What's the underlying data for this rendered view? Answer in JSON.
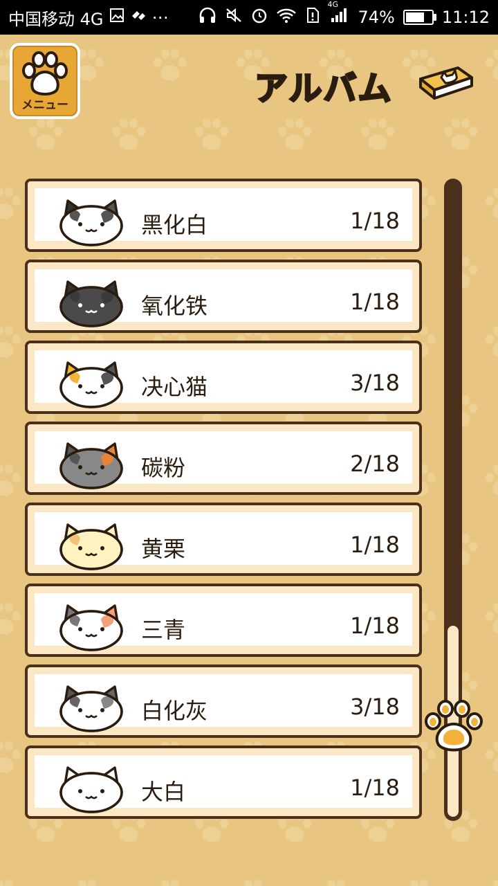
{
  "status_bar": {
    "carrier": "中国移动 4G",
    "network": "4G",
    "battery_percent": "74%",
    "battery_level": 0.74,
    "time": "11:12"
  },
  "header": {
    "menu_label": "メニュー",
    "title": "アルバム"
  },
  "colors": {
    "background": "#e8c681",
    "accent": "#e8a634",
    "border": "#4a2f1a",
    "row_bg": "#fbe7c3"
  },
  "cats": [
    {
      "name": "黑化白",
      "count": "1/18",
      "coat": "white-black"
    },
    {
      "name": "氧化铁",
      "count": "1/18",
      "coat": "dark-gray"
    },
    {
      "name": "决心猫",
      "count": "3/18",
      "coat": "calico"
    },
    {
      "name": "碳粉",
      "count": "2/18",
      "coat": "gray-orange"
    },
    {
      "name": "黄栗",
      "count": "1/18",
      "coat": "cream"
    },
    {
      "name": "三青",
      "count": "1/18",
      "coat": "gray-white-tabby"
    },
    {
      "name": "白化灰",
      "count": "3/18",
      "coat": "white-gray"
    },
    {
      "name": "大白",
      "count": "1/18",
      "coat": "white"
    }
  ],
  "scroll": {
    "position": 0.72
  }
}
